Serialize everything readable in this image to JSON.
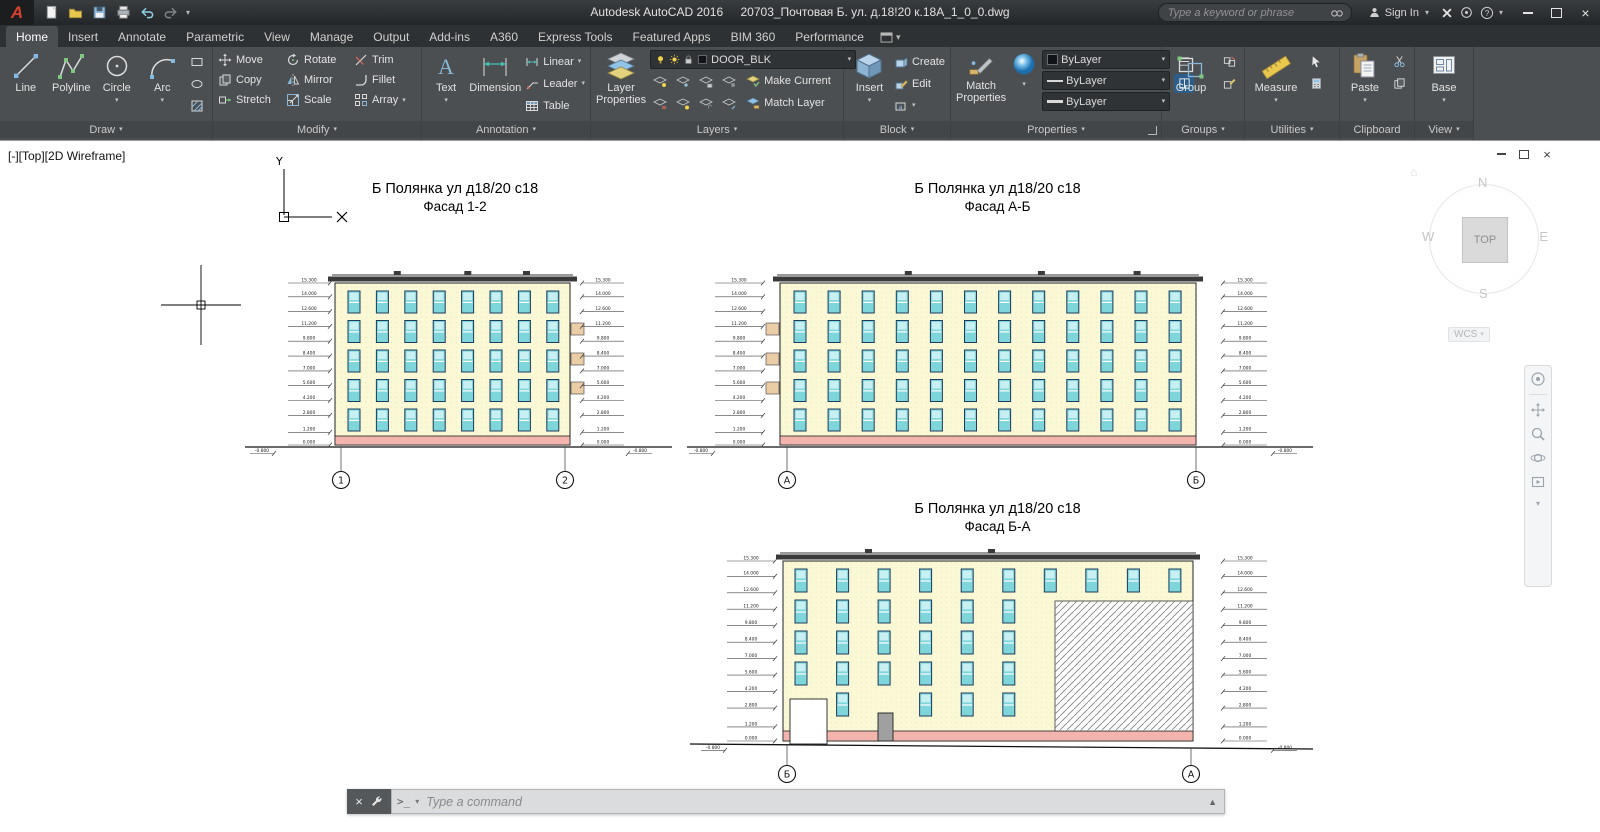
{
  "titlebar": {
    "app_title": "Autodesk AutoCAD 2016",
    "doc_title": "20703_Почтовая Б. ул. д.18!20 к.18А_1_0_0.dwg",
    "search_placeholder": "Type a keyword or phrase",
    "sign_in_label": "Sign In"
  },
  "tabs": {
    "items": [
      "Home",
      "Insert",
      "Annotate",
      "Parametric",
      "View",
      "Manage",
      "Output",
      "Add-ins",
      "A360",
      "Express Tools",
      "Featured Apps",
      "BIM 360",
      "Performance"
    ],
    "active": "Home"
  },
  "ribbon": {
    "draw": {
      "label": "Draw",
      "items": [
        "Line",
        "Polyline",
        "Circle",
        "Arc"
      ]
    },
    "modify": {
      "label": "Modify",
      "items": [
        "Move",
        "Rotate",
        "Trim",
        "Copy",
        "Mirror",
        "Fillet",
        "Stretch",
        "Scale",
        "Array"
      ]
    },
    "annotation": {
      "label": "Annotation",
      "items": [
        "Text",
        "Dimension",
        "Linear",
        "Leader",
        "Table"
      ]
    },
    "layers": {
      "label": "Layers",
      "combo_value": "DOOR_BLK",
      "items": [
        "Layer Properties",
        "Make Current",
        "Match Layer"
      ]
    },
    "block": {
      "label": "Block",
      "items": [
        "Insert",
        "Create",
        "Edit"
      ]
    },
    "properties": {
      "label": "Properties",
      "match_properties": "Match Properties",
      "bylayer": "ByLayer"
    },
    "groups": {
      "label": "Groups",
      "items": [
        "Group"
      ]
    },
    "utilities": {
      "label": "Utilities",
      "items": [
        "Measure"
      ]
    },
    "clipboard": {
      "label": "Clipboard",
      "items": [
        "Paste"
      ]
    },
    "view": {
      "label": "View",
      "items": [
        "Base"
      ]
    }
  },
  "viewport": {
    "label": "[-][Top][2D Wireframe]",
    "viewcube": {
      "n": "N",
      "w": "W",
      "e": "E",
      "s": "S",
      "top": "TOP",
      "wcs": "WCS"
    }
  },
  "command_line": {
    "placeholder": "Type a command"
  },
  "drawings": [
    {
      "title": "Б Полянка ул д18/20 с18",
      "subtitle": "Фасад 1-2",
      "bubble_left": "1",
      "bubble_right": "2"
    },
    {
      "title": "Б Полянка ул д18/20 с18",
      "subtitle": "Фасад А-Б",
      "bubble_left": "А",
      "bubble_right": "Б"
    },
    {
      "title": "Б Полянка ул д18/20 с18",
      "subtitle": "Фасад Б-А",
      "bubble_left": "Б",
      "bubble_right": "А"
    }
  ],
  "facade_levels": [
    "15.300",
    "14.000",
    "12.600",
    "11.200",
    "9.800",
    "8.400",
    "7.000",
    "5.600",
    "4.200",
    "2.800",
    "1.200",
    "0.000"
  ],
  "facade_low_level": "-0.800",
  "colors": {
    "wall": "#FBF8D6",
    "base": "#F2B4AC",
    "window": "#7FD6DA",
    "window_top": "#C8F0F2",
    "frame": "#1C3B5E",
    "accent_box": "#EACDA4",
    "roof": "#3A3A3A"
  }
}
